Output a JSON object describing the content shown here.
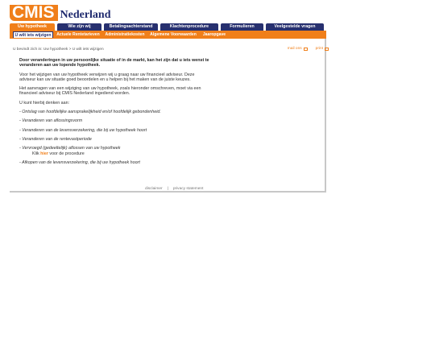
{
  "logo": {
    "mark": "CMIS",
    "name": "Nederland"
  },
  "topnav": [
    {
      "label": "Uw hypotheek"
    },
    {
      "label": "Wie zijn wij"
    },
    {
      "label": "Betalingsachterstand"
    },
    {
      "label": "Klachtenprocedure"
    },
    {
      "label": "Formulieren"
    },
    {
      "label": "Veelgestelde vragen"
    }
  ],
  "subnav": [
    {
      "label": "U wilt iets wijzigen"
    },
    {
      "label": "Actuele Rentetarieven"
    },
    {
      "label": "Administratiekosten"
    },
    {
      "label": "Algemene Voorwaarden"
    },
    {
      "label": "Jaaropgave"
    }
  ],
  "breadcrumb": "U bevindt zich in: Uw hypotheek > U wilt iets wijzigen",
  "tools": {
    "mail": "mail ons",
    "print": "print"
  },
  "main": {
    "intro": "Door veranderingen in uw persoonlijke situatie of in de markt, kan het zijn dat u iets wenst te veranderen aan uw lopende hypotheek.",
    "p1": "Voor het wijzigen van uw hypotheek verwijzen wij u graag naar uw financieel adviseur. Deze adviseur kan uw situatie goed beoordelen en u helpen bij het maken van de juiste keuzes.",
    "p2": "Het aanvragen van een wijziging van uw hypotheek, zoals hieronder omschreven, moet via een financieel adviseur bij CMIS Nederland ingediend worden.",
    "p3": "U kunt hierbij denken aan:",
    "items": [
      "- Ontslag van hoofdelijke aansprakelijkheid en/of hoofdelijk gebondenheid.",
      "- Veranderen van aflossingsvorm",
      "- Veranderen van de levensverzekering, die bij uw hypotheek hoort",
      "- Veranderen van de rentevastperiode",
      "- Vervroegd (gedeeltelijk) aflossen van uw hypotheek",
      "- Afkopen van de levensverzekering, die bij uw hypotheek hoort"
    ],
    "sub_pre": "Klik ",
    "sub_link": "hier",
    "sub_post": " voor de procedure"
  },
  "footer": {
    "disclaimer": "disclaimer",
    "sep": "|",
    "privacy": "privacy statement"
  }
}
